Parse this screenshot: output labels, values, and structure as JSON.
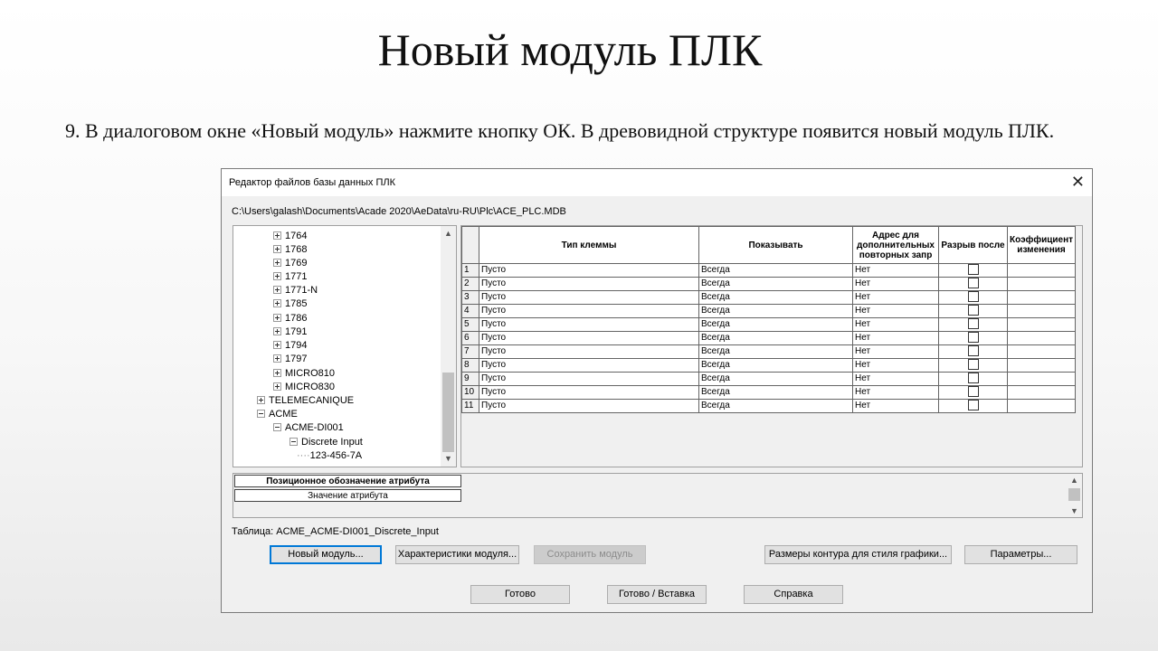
{
  "slide": {
    "title": "Новый модуль ПЛК",
    "text": "9. В диалоговом окне «Новый модуль» нажмите кнопку ОК. В древовидной структуре появится новый модуль ПЛК."
  },
  "dialog": {
    "title": "Редактор файлов базы данных ПЛК",
    "close_label": "✕",
    "path": "C:\\Users\\galash\\Documents\\Acade 2020\\AeData\\ru-RU\\Plc\\ACE_PLC.MDB",
    "tree": {
      "items": [
        {
          "label": "1764",
          "state": "collapsed"
        },
        {
          "label": "1768",
          "state": "collapsed"
        },
        {
          "label": "1769",
          "state": "collapsed"
        },
        {
          "label": "1771",
          "state": "collapsed"
        },
        {
          "label": "1771-N",
          "state": "collapsed"
        },
        {
          "label": "1785",
          "state": "collapsed"
        },
        {
          "label": "1786",
          "state": "collapsed"
        },
        {
          "label": "1791",
          "state": "collapsed"
        },
        {
          "label": "1794",
          "state": "collapsed"
        },
        {
          "label": "1797",
          "state": "collapsed"
        },
        {
          "label": "MICRO810",
          "state": "collapsed"
        },
        {
          "label": "MICRO830",
          "state": "collapsed"
        },
        {
          "label": "TELEMECANIQUE",
          "state": "collapsed"
        },
        {
          "label": "ACME",
          "state": "expanded"
        },
        {
          "label": "ACME-DI001",
          "state": "expanded"
        },
        {
          "label": "Discrete Input",
          "state": "expanded"
        },
        {
          "label": "123-456-7A",
          "state": "leaf"
        }
      ]
    },
    "grid": {
      "headers": [
        "Тип клеммы",
        "Показывать",
        "Адрес для дополнительных повторных запр",
        "Разрыв после",
        "Коэффициент изменения"
      ],
      "rows": [
        {
          "num": "1",
          "type": "Пусто",
          "show": "Всегда",
          "addr": "Нет"
        },
        {
          "num": "2",
          "type": "Пусто",
          "show": "Всегда",
          "addr": "Нет"
        },
        {
          "num": "3",
          "type": "Пусто",
          "show": "Всегда",
          "addr": "Нет"
        },
        {
          "num": "4",
          "type": "Пусто",
          "show": "Всегда",
          "addr": "Нет"
        },
        {
          "num": "5",
          "type": "Пусто",
          "show": "Всегда",
          "addr": "Нет"
        },
        {
          "num": "6",
          "type": "Пусто",
          "show": "Всегда",
          "addr": "Нет"
        },
        {
          "num": "7",
          "type": "Пусто",
          "show": "Всегда",
          "addr": "Нет"
        },
        {
          "num": "8",
          "type": "Пусто",
          "show": "Всегда",
          "addr": "Нет"
        },
        {
          "num": "9",
          "type": "Пусто",
          "show": "Всегда",
          "addr": "Нет"
        },
        {
          "num": "10",
          "type": "Пусто",
          "show": "Всегда",
          "addr": "Нет"
        },
        {
          "num": "11",
          "type": "Пусто",
          "show": "Всегда",
          "addr": "Нет"
        }
      ]
    },
    "attributes": {
      "position_label": "Позиционное обозначение атрибута",
      "value_label": "Значение атрибута"
    },
    "table_label": "Таблица: ACME_ACME-DI001_Discrete_Input",
    "buttons": {
      "new_module": "Новый модуль...",
      "module_props": "Характеристики модуля...",
      "save_module": "Сохранить модуль",
      "contour_sizes": "Размеры контура для стиля графики...",
      "params": "Параметры...",
      "done": "Готово",
      "done_insert": "Готово / Вставка",
      "help": "Справка"
    }
  }
}
